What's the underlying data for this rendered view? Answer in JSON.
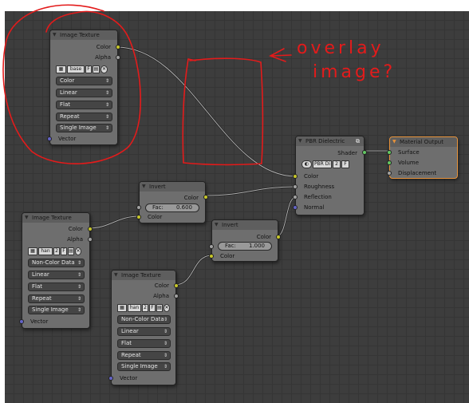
{
  "nodes": {
    "img1": {
      "title": "Image Texture",
      "out_color": "Color",
      "out_alpha": "Alpha",
      "image_name": "base",
      "image_flag": "F",
      "dd_colorspace": "Color",
      "dd_interp": "Linear",
      "dd_proj": "Flat",
      "dd_ext": "Repeat",
      "dd_source": "Single Image",
      "in_vector": "Vector"
    },
    "img2": {
      "title": "Image Texture",
      "out_color": "Color",
      "out_alpha": "Alpha",
      "image_name": "han",
      "image_users": "2",
      "image_flag": "F",
      "dd_colorspace": "Non-Color Data",
      "dd_interp": "Linear",
      "dd_proj": "Flat",
      "dd_ext": "Repeat",
      "dd_source": "Single Image",
      "in_vector": "Vector"
    },
    "img3": {
      "title": "Image Texture",
      "out_color": "Color",
      "out_alpha": "Alpha",
      "image_name": "han",
      "image_users": "2",
      "image_flag": "F",
      "dd_colorspace": "Non-Color Data",
      "dd_interp": "Linear",
      "dd_proj": "Flat",
      "dd_ext": "Repeat",
      "dd_source": "Single Image",
      "in_vector": "Vector"
    },
    "inv1": {
      "title": "Invert",
      "out_color": "Color",
      "fac_label": "Fac:",
      "fac_value": "0.600",
      "in_color": "Color"
    },
    "inv2": {
      "title": "Invert",
      "out_color": "Color",
      "fac_label": "Fac:",
      "fac_value": "1.000",
      "in_color": "Color"
    },
    "pbr": {
      "title": "PBR Dielectric",
      "out_shader": "Shader",
      "group_name": "PBR Di",
      "group_users": "2",
      "group_flag": "F",
      "in_color": "Color",
      "in_roughness": "Roughness",
      "in_reflection": "Reflection",
      "in_normal": "Normal"
    },
    "out": {
      "title": "Material Output",
      "in_surface": "Surface",
      "in_volume": "Volume",
      "in_displacement": "Displacement"
    }
  },
  "annotation": {
    "line1": "overlay",
    "line2": "image?",
    "color": "#e31b1b"
  },
  "colors": {
    "canvas": "#3d3d3d",
    "node_body": "#6e6e6e",
    "socket_color": "#c7c729",
    "socket_float": "#a1a1a1",
    "socket_vector": "#6363c7",
    "socket_shader": "#63c763",
    "selected_outline": "#e8933a"
  }
}
